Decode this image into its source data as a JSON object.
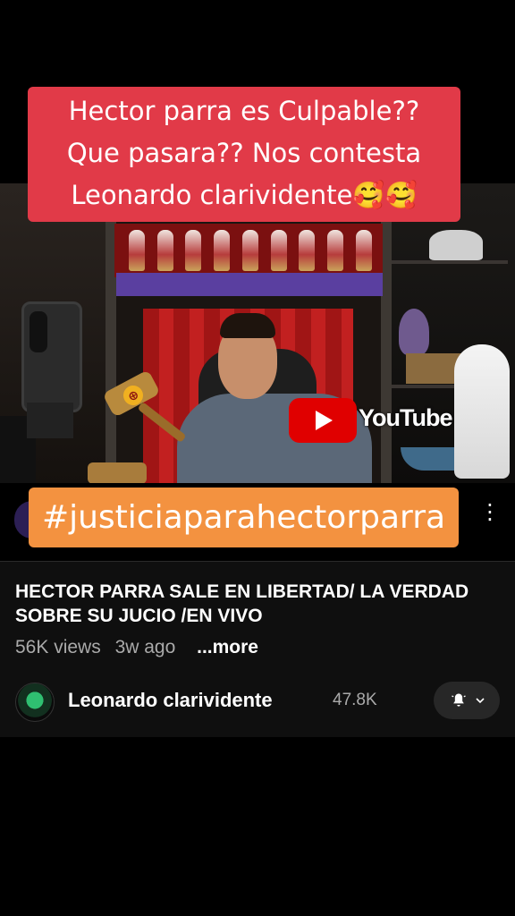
{
  "video": {
    "caption_lines": [
      "Hector parra es Culpable??",
      "Que pasara?? Nos contesta",
      " Leonardo clarividente🥰🥰"
    ],
    "hashtag": "#justiciaparahectorparra",
    "youtube_watermark": "YouTube"
  },
  "details": {
    "title": "HECTOR PARRA SALE EN LIBERTAD/ LA VERDAD SOBRE SU JUCIO /EN VIVO",
    "views": "56K views",
    "age": "3w ago",
    "more_label": "...more"
  },
  "channel": {
    "name": "Leonardo clarividente",
    "subscribers": "47.8K"
  },
  "colors": {
    "caption_bg": "#e13a48",
    "hashtag_bg": "#f39240",
    "youtube_red": "#e00000"
  },
  "icons": {
    "menu": "more-vertical-icon",
    "bell": "bell-icon",
    "chevron": "chevron-down-icon",
    "play": "youtube-play-icon"
  }
}
